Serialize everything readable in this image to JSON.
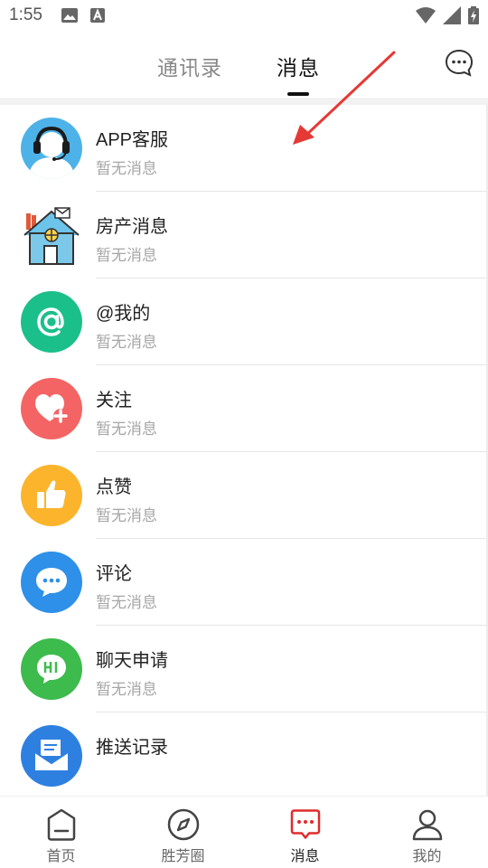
{
  "status_bar": {
    "time": "1:55"
  },
  "header": {
    "tabs": [
      {
        "label": "通讯录",
        "active": false
      },
      {
        "label": "消息",
        "active": true
      }
    ]
  },
  "messages": [
    {
      "title": "APP客服",
      "subtitle": "暂无消息",
      "icon": "customer-service-icon",
      "color": "#4db2e8"
    },
    {
      "title": "房产消息",
      "subtitle": "暂无消息",
      "icon": "house-icon",
      "color": "#7cc8e8"
    },
    {
      "title": "@我的",
      "subtitle": "暂无消息",
      "icon": "at-icon",
      "color": "#1bbf8a"
    },
    {
      "title": "关注",
      "subtitle": "暂无消息",
      "icon": "heart-plus-icon",
      "color": "#f46464"
    },
    {
      "title": "点赞",
      "subtitle": "暂无消息",
      "icon": "thumbs-up-icon",
      "color": "#fbb42c"
    },
    {
      "title": "评论",
      "subtitle": "暂无消息",
      "icon": "comment-icon",
      "color": "#2e90e8"
    },
    {
      "title": "聊天申请",
      "subtitle": "暂无消息",
      "icon": "chat-hi-icon",
      "color": "#3dbb4d"
    },
    {
      "title": "推送记录",
      "subtitle": "",
      "icon": "push-mail-icon",
      "color": "#2e80e0"
    }
  ],
  "bottom_nav": [
    {
      "label": "首页",
      "icon": "home-icon",
      "active": false
    },
    {
      "label": "胜芳圈",
      "icon": "compass-icon",
      "active": false
    },
    {
      "label": "消息",
      "icon": "message-icon",
      "active": true,
      "color": "#e02b2b"
    },
    {
      "label": "我的",
      "icon": "profile-icon",
      "active": false
    }
  ],
  "annotation": {
    "color": "#e53935"
  }
}
